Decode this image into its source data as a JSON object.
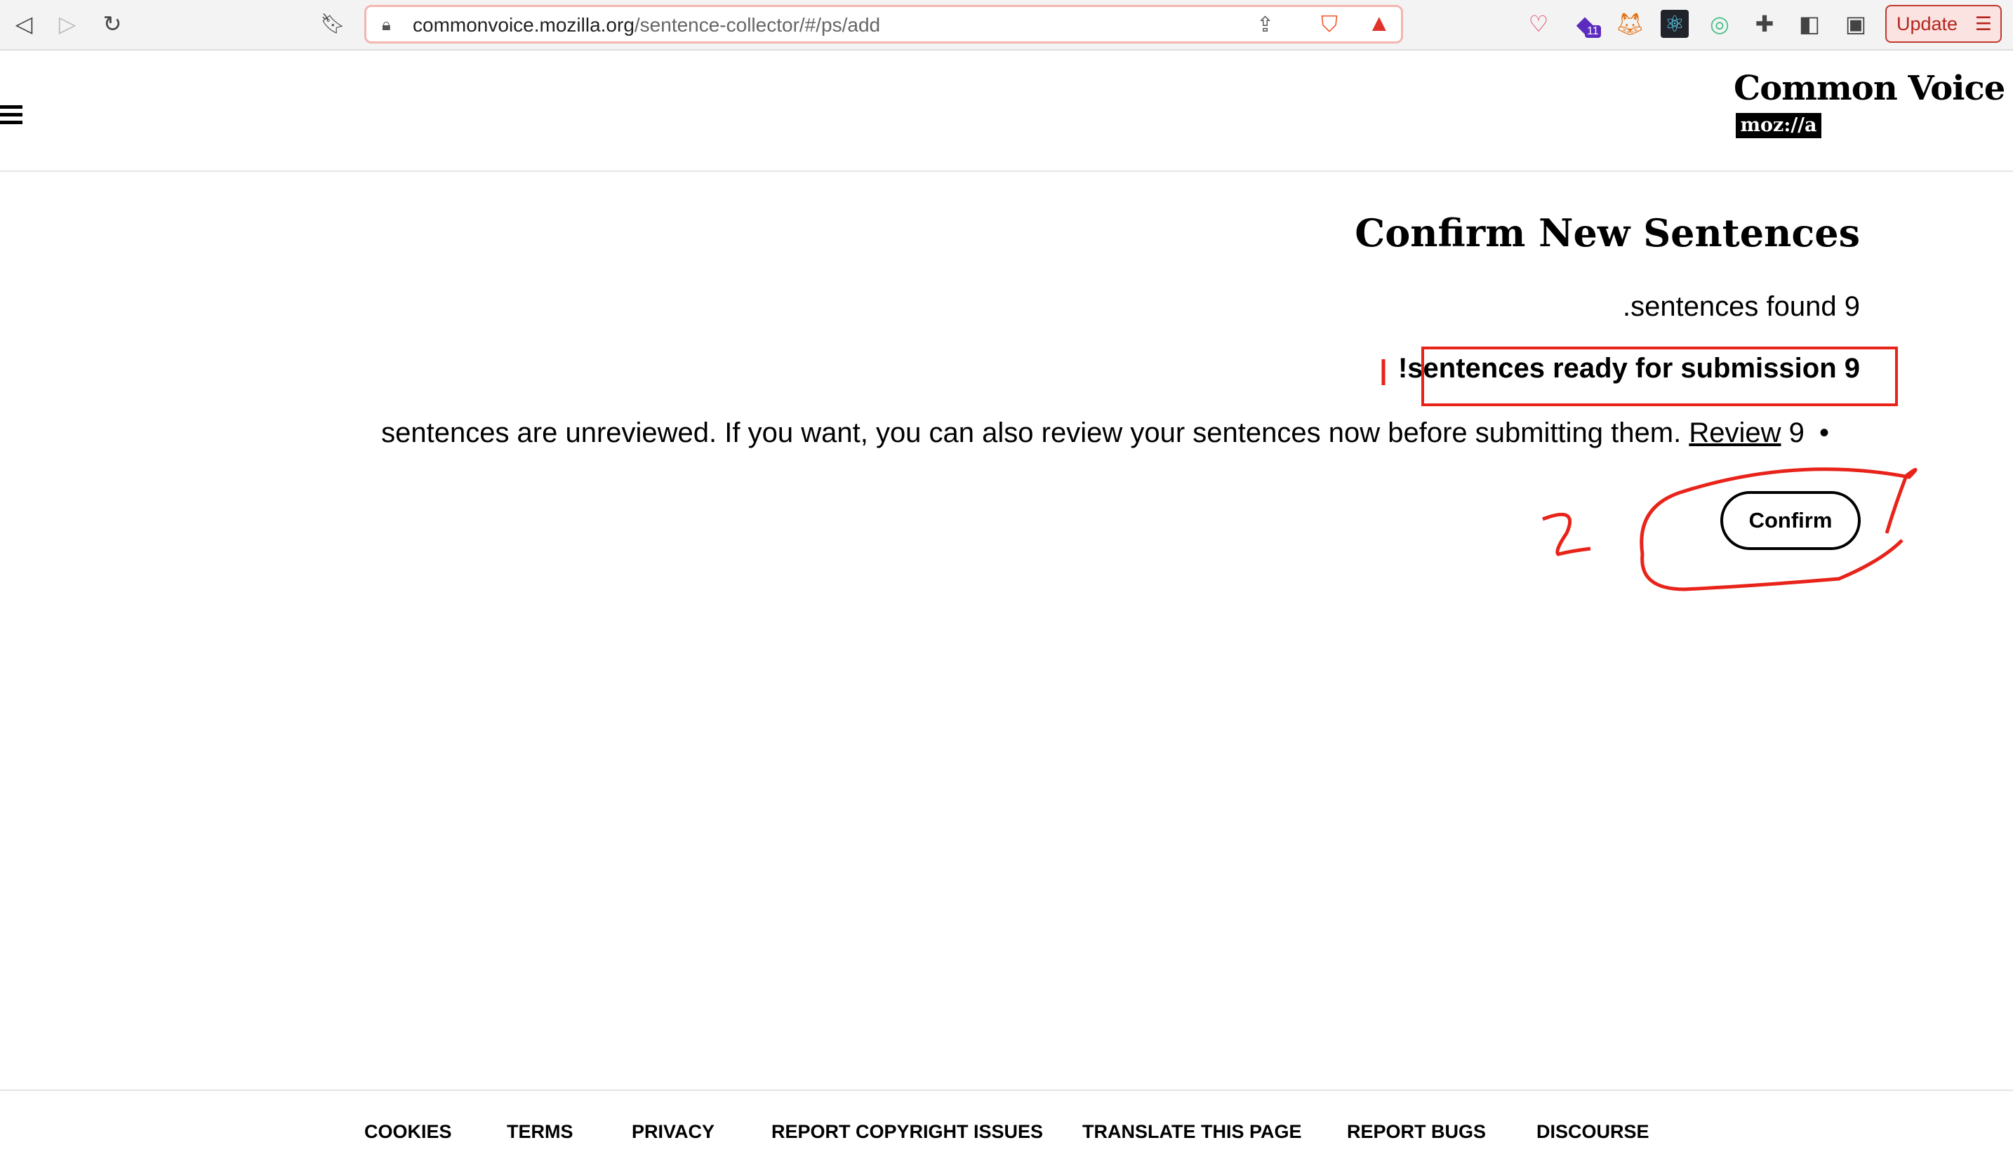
{
  "browser": {
    "url_domain": "commonvoice.mozilla.org",
    "url_path": "/sentence-collector/#/ps/add",
    "update_label": "Update",
    "extension_badge": "11"
  },
  "header": {
    "logo_text": "Common Voice",
    "logo_mark": "moz://a"
  },
  "main": {
    "title": "Confirm New Sentences",
    "found_text": ".sentences found 9",
    "ready_text": "!sentences ready for submission 9",
    "unreviewed_text": "sentences are unreviewed. If you want, you can also review your sentences now before submitting them.",
    "review_link": "Review",
    "unreviewed_count": "9",
    "bullet": "•",
    "confirm_label": "Confirm"
  },
  "annotations": {
    "mark_1": "1",
    "mark_2": "2",
    "color": "#e8231a"
  },
  "footer": {
    "links": [
      "COOKIES",
      "TERMS",
      "PRIVACY",
      "REPORT COPYRIGHT ISSUES",
      "TRANSLATE THIS PAGE",
      "REPORT BUGS",
      "DISCOURSE"
    ]
  }
}
